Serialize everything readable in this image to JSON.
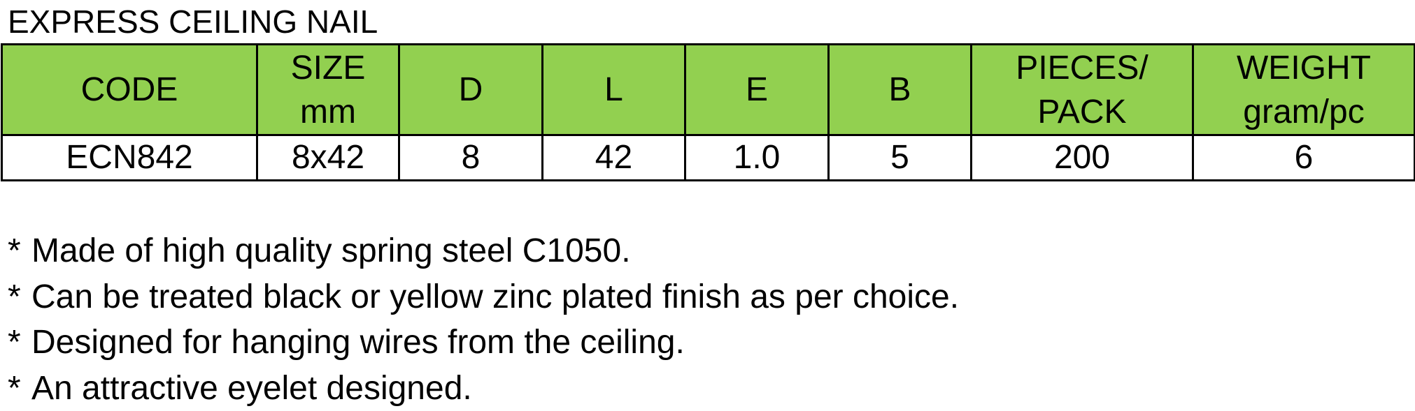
{
  "title": "EXPRESS CEILING NAIL",
  "colors": {
    "header_background": "#92D050",
    "body_background": "#FFFFFF",
    "border": "#000000"
  },
  "table": {
    "columns": [
      {
        "line1": "CODE",
        "line2": ""
      },
      {
        "line1": "SIZE",
        "line2": "mm"
      },
      {
        "line1": "D",
        "line2": ""
      },
      {
        "line1": "L",
        "line2": ""
      },
      {
        "line1": "E",
        "line2": ""
      },
      {
        "line1": "B",
        "line2": ""
      },
      {
        "line1": "PIECES/",
        "line2": "PACK"
      },
      {
        "line1": "WEIGHT",
        "line2": "gram/pc"
      }
    ],
    "rows": [
      [
        "ECN842",
        "8x42",
        "8",
        "42",
        "1.0",
        "5",
        "200",
        "6"
      ]
    ]
  },
  "notes": {
    "bullet": "*",
    "items": [
      "Made of high quality spring steel C1050.",
      "Can be treated black or yellow zinc plated finish as per choice.",
      "Designed for hanging wires from the ceiling.",
      "An attractive eyelet designed."
    ]
  }
}
